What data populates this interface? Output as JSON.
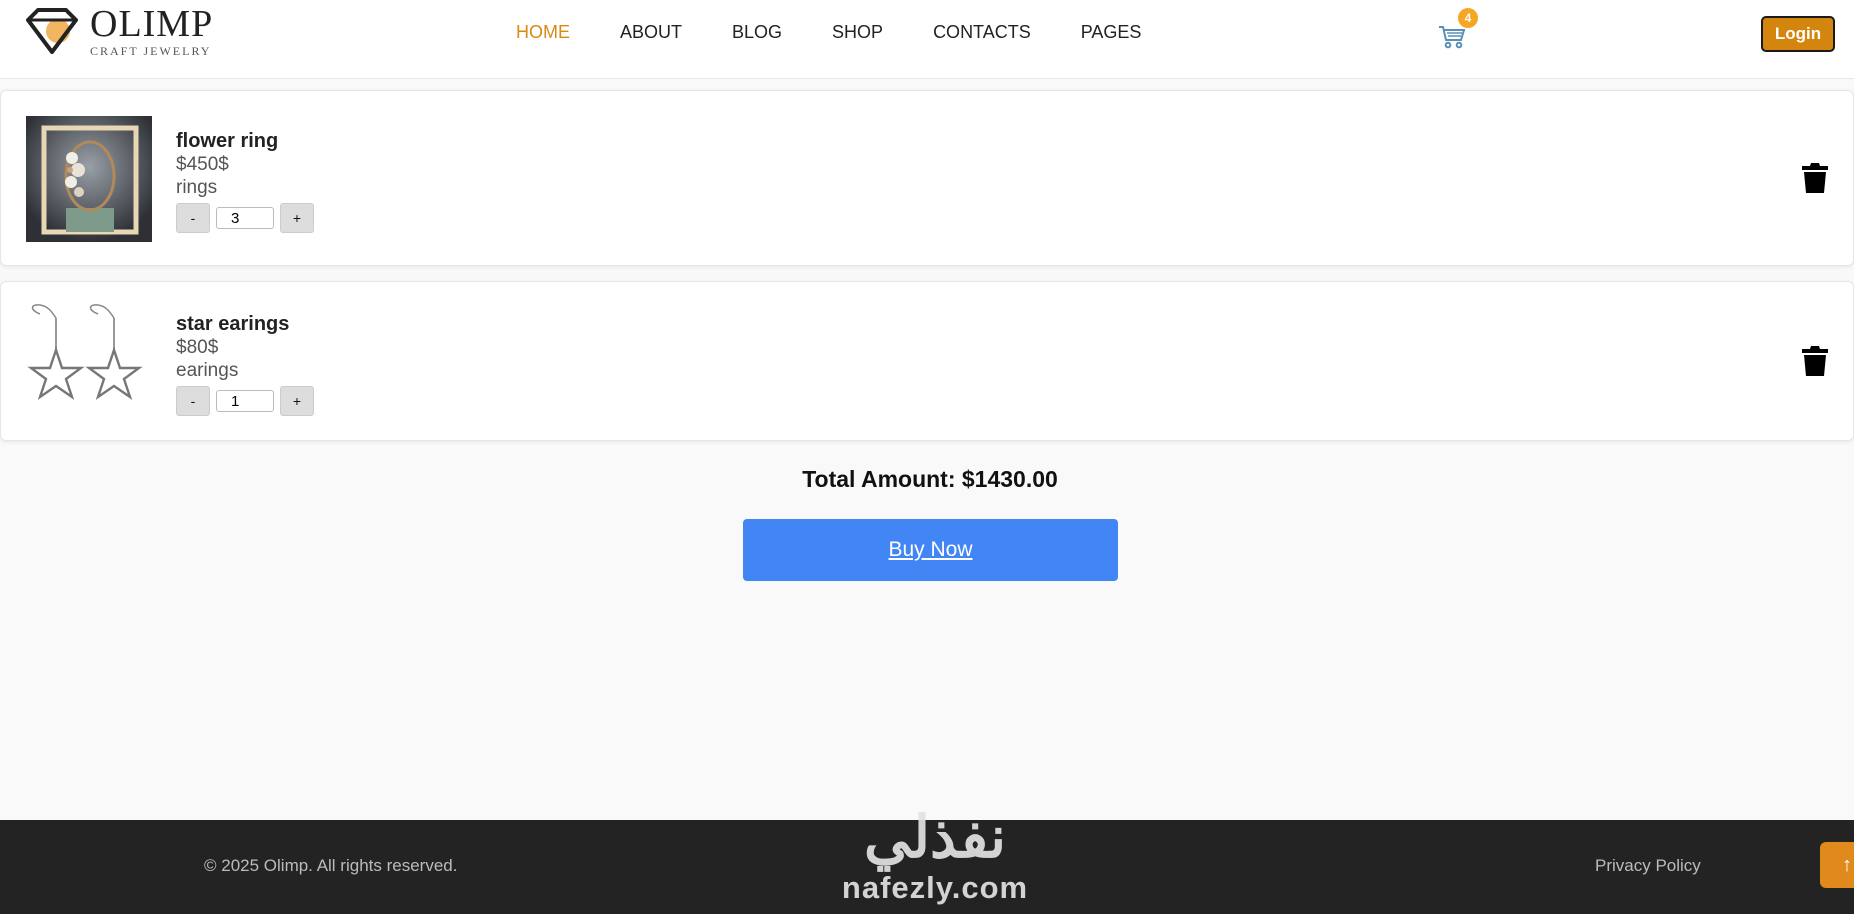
{
  "header": {
    "logo_name": "OLIMP",
    "logo_tagline": "CRAFT JEWELRY",
    "nav": [
      {
        "label": "HOME",
        "active": true
      },
      {
        "label": "ABOUT",
        "active": false
      },
      {
        "label": "BLOG",
        "active": false
      },
      {
        "label": "SHOP",
        "active": false
      },
      {
        "label": "CONTACTS",
        "active": false
      },
      {
        "label": "PAGES",
        "active": false
      }
    ],
    "cart_count": "4",
    "cart_icon": "shopping-cart-icon",
    "login_label": "Login"
  },
  "cart": {
    "items": [
      {
        "name": "flower ring",
        "price": "$450$",
        "category": "rings",
        "quantity": "3",
        "decrement_label": "-",
        "increment_label": "+",
        "image": "flower-ring-photo",
        "delete_icon": "trash-icon"
      },
      {
        "name": "star earings",
        "price": "$80$",
        "category": "earings",
        "quantity": "1",
        "decrement_label": "-",
        "increment_label": "+",
        "image": "star-earrings-photo",
        "delete_icon": "trash-icon"
      }
    ],
    "total_label": "Total Amount: $1430.00",
    "buy_label": "Buy Now"
  },
  "footer": {
    "copyright": "© 2025 Olimp. All rights reserved.",
    "privacy_label": "Privacy Policy",
    "back_to_top_label": "↑"
  },
  "watermark": {
    "arabic": "نفذلي",
    "latin": "nafezly.com"
  },
  "colors": {
    "accent": "#d98a14",
    "login_bg": "#d4850e",
    "buy_button": "#4285f4",
    "footer_bg": "#232323",
    "badge": "#f5a623"
  }
}
